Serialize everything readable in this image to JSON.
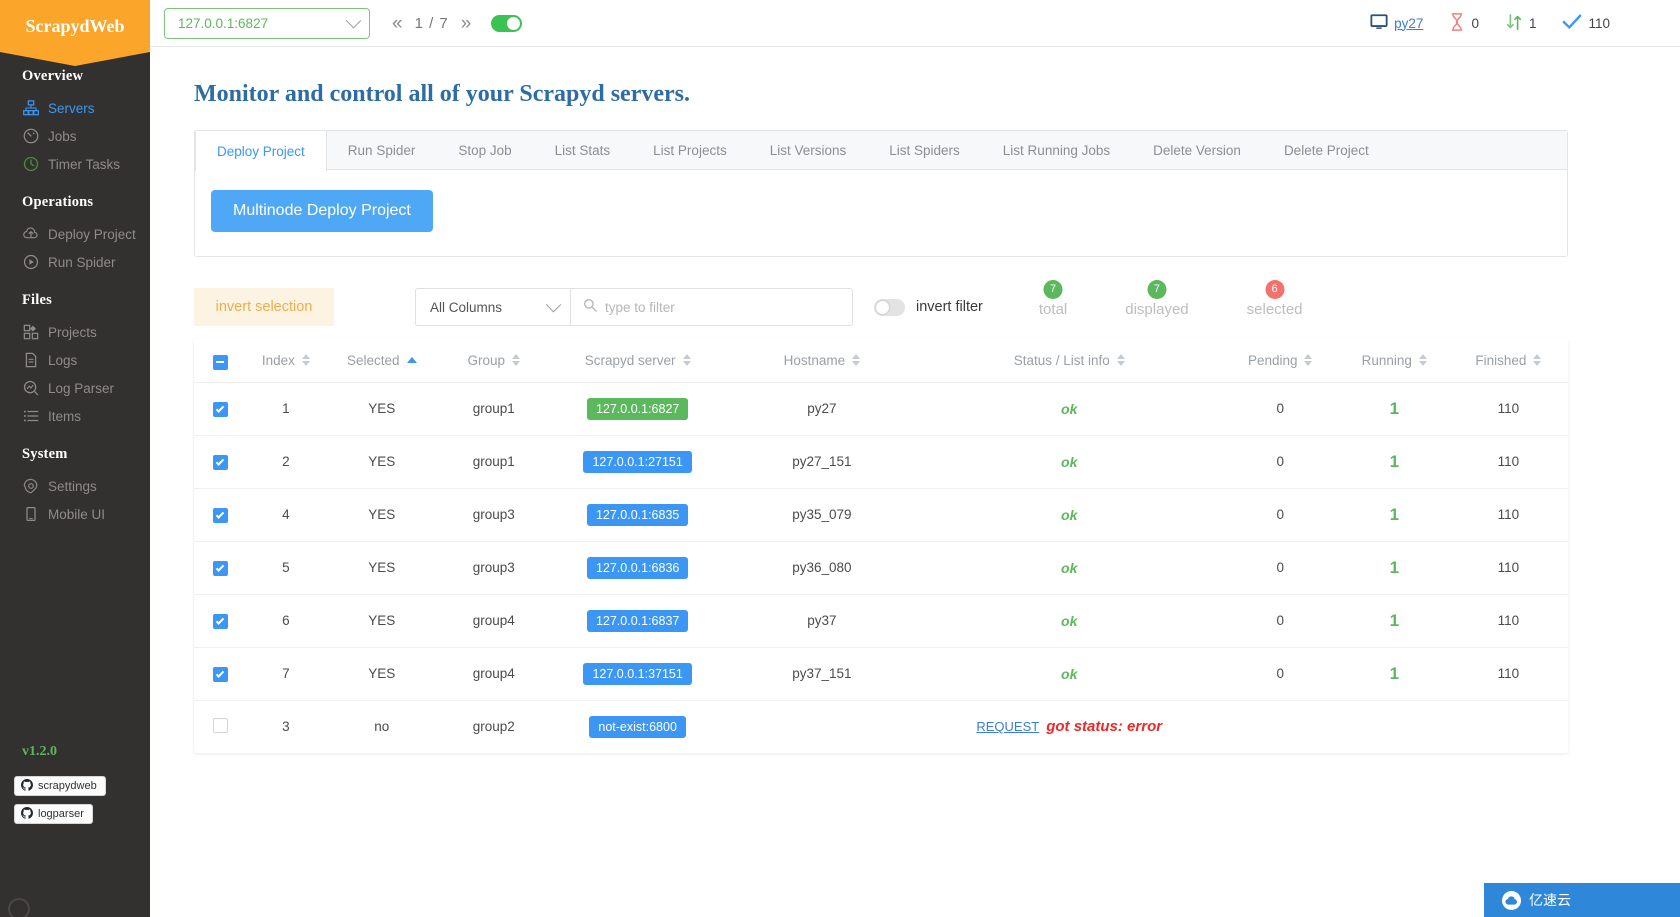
{
  "brand": {
    "name": "ScrapydWeb",
    "version": "v1.2.0"
  },
  "sidebar": {
    "sections": [
      {
        "title": "Overview",
        "items": [
          {
            "label": "Servers",
            "icon": "sitemap-icon",
            "active": true
          },
          {
            "label": "Jobs",
            "icon": "dashboard-icon",
            "active": false
          },
          {
            "label": "Timer Tasks",
            "icon": "clock-icon",
            "active": false
          }
        ]
      },
      {
        "title": "Operations",
        "items": [
          {
            "label": "Deploy Project",
            "icon": "cloud-upload-icon",
            "active": false
          },
          {
            "label": "Run Spider",
            "icon": "play-circle-icon",
            "active": false
          }
        ]
      },
      {
        "title": "Files",
        "items": [
          {
            "label": "Projects",
            "icon": "grid-icon",
            "active": false
          },
          {
            "label": "Logs",
            "icon": "file-icon",
            "active": false
          },
          {
            "label": "Log Parser",
            "icon": "analytics-icon",
            "active": false
          },
          {
            "label": "Items",
            "icon": "list-icon",
            "active": false
          }
        ]
      },
      {
        "title": "System",
        "items": [
          {
            "label": "Settings",
            "icon": "gear-icon",
            "active": false
          },
          {
            "label": "Mobile UI",
            "icon": "mobile-icon",
            "active": false
          }
        ]
      }
    ],
    "badges": [
      {
        "label": "scrapydweb",
        "icon": "github-icon"
      },
      {
        "label": "logparser",
        "icon": "github-icon"
      }
    ]
  },
  "topbar": {
    "node_select_value": "127.0.0.1:6827",
    "prev_label": "«",
    "next_label": "»",
    "pager_label": "1 / 7",
    "auto_toggle_on": true,
    "status": {
      "monitor_icon": "monitor-icon",
      "hostname": "py27",
      "pending_icon": "hourglass-icon",
      "pending": "0",
      "running_icon": "arrows-updown-icon",
      "running": "1",
      "finished_icon": "check-icon",
      "finished": "110"
    }
  },
  "main": {
    "page_title": "Monitor and control all of your Scrapyd servers.",
    "tabs": [
      {
        "label": "Deploy Project",
        "active": true
      },
      {
        "label": "Run Spider",
        "active": false
      },
      {
        "label": "Stop Job",
        "active": false
      },
      {
        "label": "List Stats",
        "active": false
      },
      {
        "label": "List Projects",
        "active": false
      },
      {
        "label": "List Versions",
        "active": false
      },
      {
        "label": "List Spiders",
        "active": false
      },
      {
        "label": "List Running Jobs",
        "active": false
      },
      {
        "label": "Delete Version",
        "active": false
      },
      {
        "label": "Delete Project",
        "active": false
      }
    ],
    "primary_action": "Multinode Deploy Project",
    "toolbar": {
      "invert_selection": "invert selection",
      "column_select_value": "All Columns",
      "filter_placeholder": "type to filter",
      "filter_value": "",
      "search_icon": "search-icon",
      "invert_filter_label": "invert filter",
      "invert_filter_on": false,
      "counters": [
        {
          "label": "total",
          "value": "7",
          "color": "#5cb85c"
        },
        {
          "label": "displayed",
          "value": "7",
          "color": "#5cb85c"
        },
        {
          "label": "selected",
          "value": "6",
          "color": "#f2736e"
        }
      ]
    },
    "table": {
      "columns": [
        {
          "key": "checkbox",
          "label": "",
          "sortable": false
        },
        {
          "key": "index",
          "label": "Index",
          "sortable": true,
          "sort_active": false
        },
        {
          "key": "selected",
          "label": "Selected",
          "sortable": true,
          "sort_active": true
        },
        {
          "key": "group",
          "label": "Group",
          "sortable": true,
          "sort_active": false
        },
        {
          "key": "server",
          "label": "Scrapyd server",
          "sortable": true,
          "sort_active": false
        },
        {
          "key": "hostname",
          "label": "Hostname",
          "sortable": true,
          "sort_active": false
        },
        {
          "key": "status",
          "label": "Status / List info",
          "sortable": true,
          "sort_active": false
        },
        {
          "key": "pending",
          "label": "Pending",
          "sortable": true,
          "sort_active": false
        },
        {
          "key": "running",
          "label": "Running",
          "sortable": true,
          "sort_active": false
        },
        {
          "key": "finished",
          "label": "Finished",
          "sortable": true,
          "sort_active": false
        }
      ],
      "rows": [
        {
          "checked": true,
          "index": "1",
          "selected": "YES",
          "group": "group1",
          "server": "127.0.0.1:6827",
          "server_color": "green",
          "hostname": "py27",
          "status": "ok",
          "status_type": "ok",
          "pending": "0",
          "running": "1",
          "finished": "110"
        },
        {
          "checked": true,
          "index": "2",
          "selected": "YES",
          "group": "group1",
          "server": "127.0.0.1:27151",
          "server_color": "blue",
          "hostname": "py27_151",
          "status": "ok",
          "status_type": "ok",
          "pending": "0",
          "running": "1",
          "finished": "110"
        },
        {
          "checked": true,
          "index": "4",
          "selected": "YES",
          "group": "group3",
          "server": "127.0.0.1:6835",
          "server_color": "blue",
          "hostname": "py35_079",
          "status": "ok",
          "status_type": "ok",
          "pending": "0",
          "running": "1",
          "finished": "110"
        },
        {
          "checked": true,
          "index": "5",
          "selected": "YES",
          "group": "group3",
          "server": "127.0.0.1:6836",
          "server_color": "blue",
          "hostname": "py36_080",
          "status": "ok",
          "status_type": "ok",
          "pending": "0",
          "running": "1",
          "finished": "110"
        },
        {
          "checked": true,
          "index": "6",
          "selected": "YES",
          "group": "group4",
          "server": "127.0.0.1:6837",
          "server_color": "blue",
          "hostname": "py37",
          "status": "ok",
          "status_type": "ok",
          "pending": "0",
          "running": "1",
          "finished": "110"
        },
        {
          "checked": true,
          "index": "7",
          "selected": "YES",
          "group": "group4",
          "server": "127.0.0.1:37151",
          "server_color": "blue",
          "hostname": "py37_151",
          "status": "ok",
          "status_type": "ok",
          "pending": "0",
          "running": "1",
          "finished": "110"
        },
        {
          "checked": false,
          "index": "3",
          "selected": "no",
          "group": "group2",
          "server": "not-exist:6800",
          "server_color": "blue",
          "hostname": "",
          "status": "got status: error",
          "status_type": "error",
          "status_link": "REQUEST",
          "pending": "",
          "running": "",
          "finished": ""
        }
      ]
    }
  },
  "watermark": {
    "label": "亿速云",
    "icon": "cloud-icon"
  }
}
